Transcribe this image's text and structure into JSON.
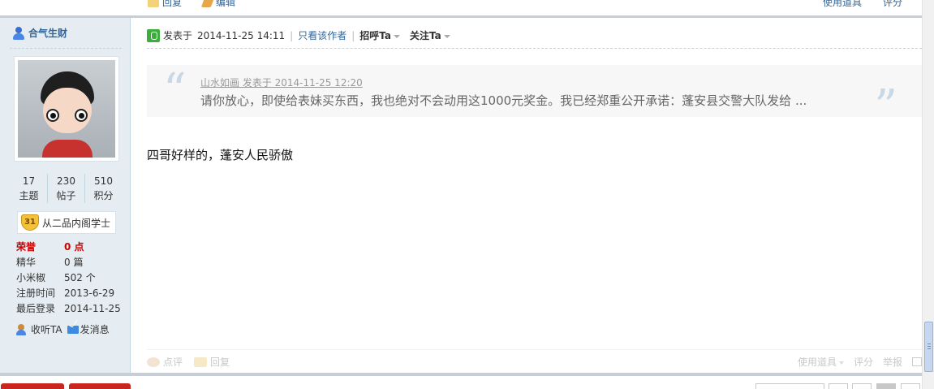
{
  "prev_post_bar": {
    "reply_label": "回复",
    "edit_label": "编辑",
    "tools_label": "使用道具",
    "rate_label": "评分"
  },
  "sidebar": {
    "author_name": "合气生财",
    "stats": [
      {
        "value": "17",
        "label": "主题"
      },
      {
        "value": "230",
        "label": "帖子"
      },
      {
        "value": "510",
        "label": "积分"
      }
    ],
    "rank": {
      "level": "31",
      "title": "从二品内阁学士"
    },
    "info": [
      {
        "key": "荣誉",
        "value": "0 点",
        "highlight": true
      },
      {
        "key": "精华",
        "value": "0 篇"
      },
      {
        "key": "小米椒",
        "value": "502 个"
      },
      {
        "key": "注册时间",
        "value": "2013-6-29"
      },
      {
        "key": "最后登录",
        "value": "2014-11-25"
      }
    ],
    "actions": {
      "follow_label": "收听TA",
      "message_label": "发消息"
    }
  },
  "post": {
    "posted_prefix": "发表于",
    "posted_time": "2014-11-25 14:11",
    "only_author_label": "只看该作者",
    "greet_label": "招呼Ta",
    "follow_label": "关注Ta",
    "quote": {
      "header": "山水如画 发表于 2014-11-25 12:20",
      "body": "请你放心，即使给表妹买东西，我也绝对不会动用这1000元奖金。我已经郑重公开承诺：蓬安县交警大队发给 ..."
    },
    "message": "四哥好样的，蓬安人民骄傲"
  },
  "post_footer": {
    "comment_label": "点评",
    "reply_label": "回复",
    "tools_label": "使用道具",
    "rate_label": "评分",
    "report_label": "举报"
  },
  "colors": {
    "sidebar_bg": "#e5edf2",
    "link": "#336699",
    "honor_red": "#cc0000",
    "action_red": "#c8261e"
  }
}
